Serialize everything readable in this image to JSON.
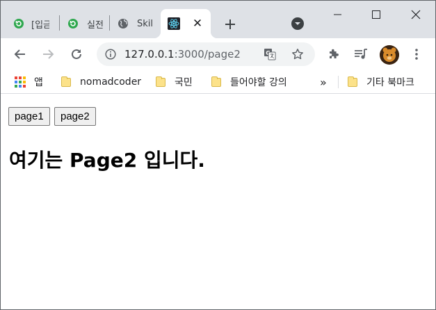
{
  "browser": {
    "tabs": [
      {
        "title": "[입금",
        "favicon": "refresh-icon-green",
        "active": false
      },
      {
        "title": "실전",
        "favicon": "refresh-icon-green",
        "active": false
      },
      {
        "title": "Skil",
        "favicon": "globe-icon",
        "active": false
      },
      {
        "title": "",
        "favicon": "react-icon",
        "active": true
      }
    ],
    "new_tab_label": "+",
    "close_glyph": "✕",
    "address": {
      "host": "127.0.0.1",
      "path": ":3000/page2"
    },
    "bookmarks": [
      {
        "label": "앱",
        "icon": "apps-grid-icon"
      },
      {
        "label": "nomadcoder",
        "icon": "folder-icon"
      },
      {
        "label": "국민",
        "icon": "folder-icon"
      },
      {
        "label": "들어야할 강의",
        "icon": "folder-icon"
      },
      {
        "label": "기타 북마크",
        "icon": "folder-icon"
      }
    ],
    "overflow_label": "»",
    "accent": "#1a73e8",
    "tabstrip_color": "#dee1e6"
  },
  "page": {
    "buttons": [
      "page1",
      "page2"
    ],
    "heading": "여기는 Page2 입니다."
  }
}
